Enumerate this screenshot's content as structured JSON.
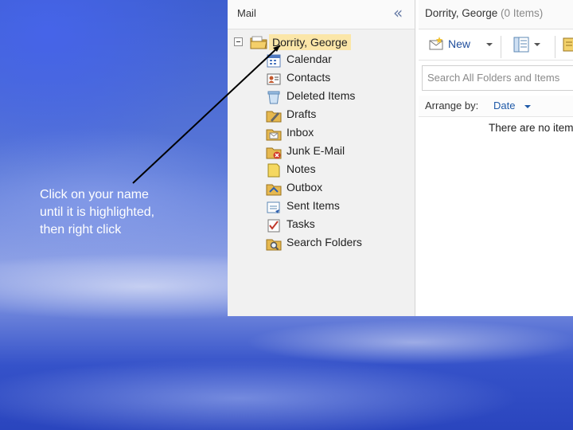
{
  "caption": {
    "lines": [
      "Click on your name",
      "until it is highlighted,",
      "then right click"
    ]
  },
  "nav": {
    "title": "Mail",
    "collapse_glyph": "«",
    "root": {
      "label": "Dorrity, George",
      "icon": "mailbox-folder-icon",
      "highlight_color": "#fbe6a8"
    },
    "folders": [
      {
        "label": "Calendar",
        "icon": "calendar-icon"
      },
      {
        "label": "Contacts",
        "icon": "contacts-icon"
      },
      {
        "label": "Deleted Items",
        "icon": "deleted-items-icon"
      },
      {
        "label": "Drafts",
        "icon": "drafts-icon"
      },
      {
        "label": "Inbox",
        "icon": "inbox-icon"
      },
      {
        "label": "Junk E-Mail",
        "icon": "junk-mail-icon"
      },
      {
        "label": "Notes",
        "icon": "notes-icon"
      },
      {
        "label": "Outbox",
        "icon": "outbox-icon"
      },
      {
        "label": "Sent Items",
        "icon": "sent-items-icon"
      },
      {
        "label": "Tasks",
        "icon": "tasks-icon"
      },
      {
        "label": "Search Folders",
        "icon": "search-folders-icon"
      }
    ]
  },
  "content": {
    "title": "Dorrity, George",
    "count": "(0 Items)",
    "toolbar": {
      "new_label": "New"
    },
    "search_placeholder": "Search All Folders and Items",
    "arrange_label": "Arrange by:",
    "arrange_value": "Date",
    "empty_message": "There are no items to show in this view."
  }
}
